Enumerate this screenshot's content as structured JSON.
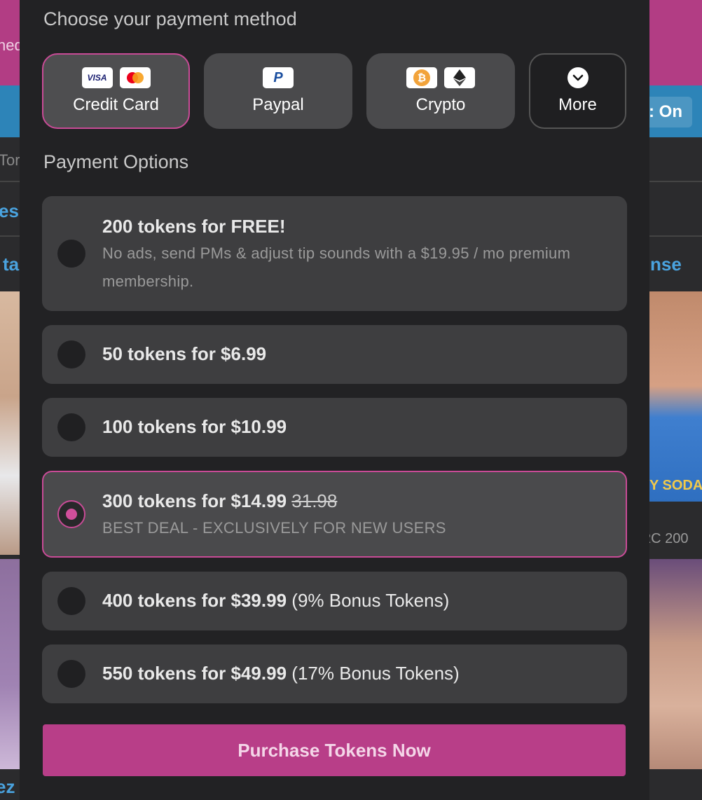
{
  "background": {
    "left_texts": [
      "hed",
      "Tor",
      "es",
      "ta",
      "ez"
    ],
    "right_texts": {
      "toggle": ": On",
      "link": "nse",
      "caption": "Y SODA S",
      "count": "2C 200"
    }
  },
  "header": {
    "title": "Choose your payment method"
  },
  "payment_methods": [
    {
      "label": "Credit Card",
      "icons": [
        "visa-icon",
        "mastercard-icon"
      ],
      "icon_text": [
        "VISA",
        ""
      ]
    },
    {
      "label": "Paypal",
      "icons": [
        "paypal-icon"
      ],
      "icon_text": [
        "P"
      ]
    },
    {
      "label": "Crypto",
      "icons": [
        "bitcoin-icon",
        "ethereum-icon"
      ],
      "icon_text": [
        "B",
        ""
      ]
    },
    {
      "label": "More",
      "icons": [
        "chevron-down-icon"
      ],
      "icon_text": [
        ""
      ]
    }
  ],
  "options_section": {
    "title": "Payment Options",
    "options": [
      {
        "title": "200 tokens for FREE!",
        "subtitle": "No ads, send PMs & adjust tip sounds with a $19.95 / mo premium membership.",
        "selected": false
      },
      {
        "title": "50 tokens for $6.99",
        "selected": false
      },
      {
        "title": "100 tokens for $10.99",
        "selected": false
      },
      {
        "title": "300 tokens for $14.99",
        "strike_price": "31.98",
        "subtitle": "BEST DEAL - EXCLUSIVELY FOR NEW USERS",
        "selected": true
      },
      {
        "title": "400 tokens for $39.99",
        "bonus": "(9% Bonus Tokens)",
        "selected": false
      },
      {
        "title": "550 tokens for $49.99",
        "bonus": "(17% Bonus Tokens)",
        "selected": false
      }
    ]
  },
  "purchase_button": {
    "label": "Purchase Tokens Now"
  },
  "colors": {
    "accent": "#c84b96",
    "button": "#b83e88",
    "modal_bg": "#222224",
    "option_bg": "#3e3e40"
  }
}
